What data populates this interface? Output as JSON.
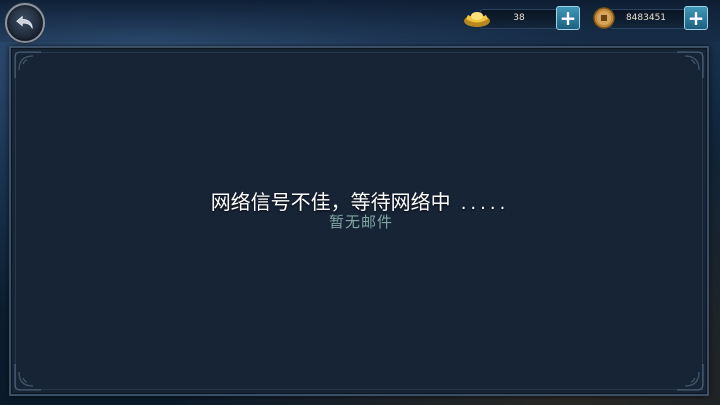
{
  "header": {
    "back_icon": "back-arrow-icon",
    "gold": {
      "icon": "gold-ingot-icon",
      "value": "38"
    },
    "coins": {
      "icon": "copper-coin-icon",
      "value": "8483451"
    },
    "plus_label": "+"
  },
  "mail": {
    "empty_text": "暂无邮件"
  },
  "overlay": {
    "network_message": "网络信号不佳，等待网络中",
    "dots": "....."
  },
  "colors": {
    "panel_bg": "#172436",
    "accent_button": "#3f97b8",
    "empty_text": "#7fa6a2"
  }
}
